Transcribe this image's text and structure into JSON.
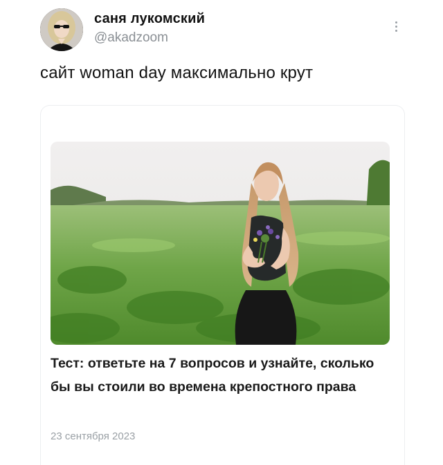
{
  "author": {
    "name": "саня лукомский",
    "handle": "@akadzoom"
  },
  "post": {
    "text": "сайт woman day максимально крут"
  },
  "card": {
    "title": "Тест: ответьте на 7 вопросов и узнайте, сколько бы вы стоили во времена крепостного права",
    "date": "23 сентября 2023"
  },
  "icons": {
    "more": "more-vertical-icon"
  }
}
